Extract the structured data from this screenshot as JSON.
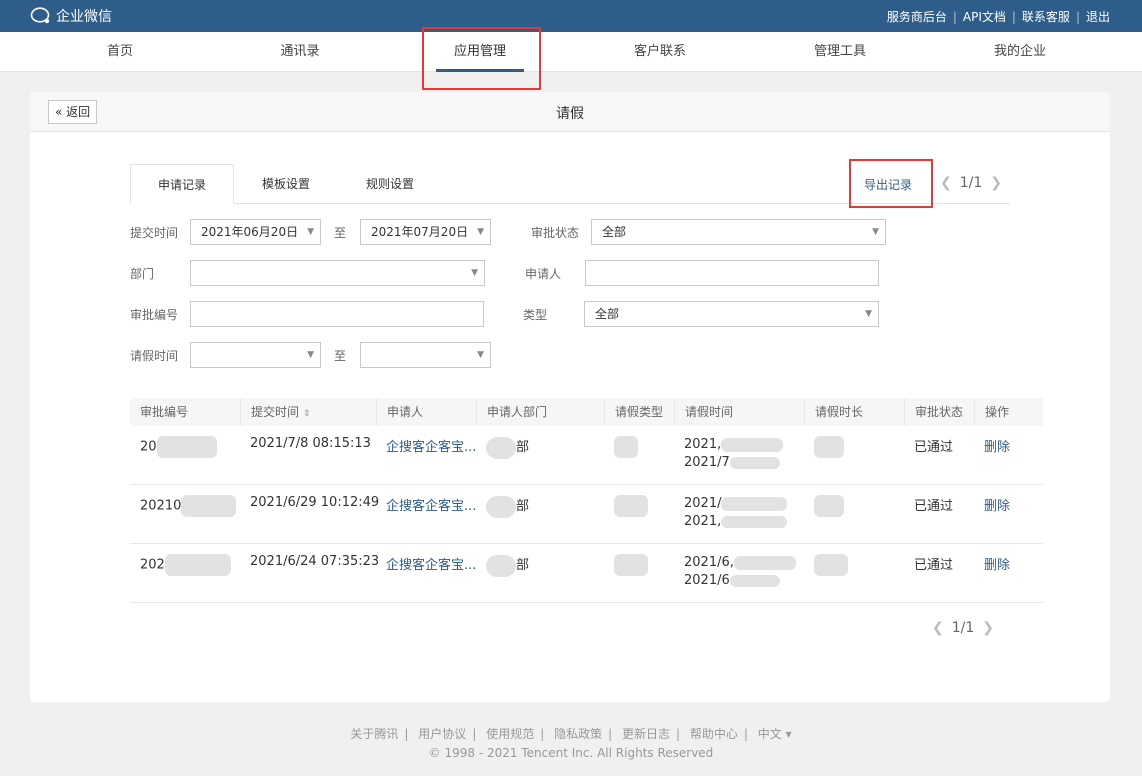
{
  "topbar": {
    "app_name": "企业微信",
    "links": [
      "服务商后台",
      "API文档",
      "联系客服",
      "退出"
    ]
  },
  "nav": {
    "items": [
      "首页",
      "通讯录",
      "应用管理",
      "客户联系",
      "管理工具",
      "我的企业"
    ],
    "active": "应用管理"
  },
  "page": {
    "back_label": "返回",
    "title": "请假"
  },
  "tabs": [
    "申请记录",
    "模板设置",
    "规则设置"
  ],
  "toolbar": {
    "export_label": "导出记录",
    "page_indicator": "1/1"
  },
  "filters": {
    "submit_time_label": "提交时间",
    "submit_start": "2021年06月20日",
    "to_label": "至",
    "submit_end": "2021年07月20日",
    "status_label": "审批状态",
    "status_value": "全部",
    "dept_label": "部门",
    "applicant_label": "申请人",
    "approval_no_label": "审批编号",
    "type_label": "类型",
    "type_value": "全部",
    "leave_time_label": "请假时间"
  },
  "table": {
    "headers": [
      "审批编号",
      "提交时间",
      "申请人",
      "申请人部门",
      "请假类型",
      "请假时间",
      "请假时长",
      "审批状态",
      "操作"
    ],
    "rows": [
      {
        "no": "20",
        "submitted": "2021/7/8 08:15:13",
        "applicant": "企搜客企客宝...",
        "dept": "部",
        "time1": "2021,",
        "time2": "2021/7",
        "status": "已通过",
        "action": "删除"
      },
      {
        "no": "20210",
        "submitted": "2021/6/29 10:12:49",
        "applicant": "企搜客企客宝...",
        "dept": "部",
        "time1": "2021/",
        "time2": "2021,",
        "status": "已通过",
        "action": "删除"
      },
      {
        "no": "202",
        "submitted": "2021/6/24 07:35:23",
        "applicant": "企搜客企客宝...",
        "dept": "部",
        "time1": "2021/6,",
        "time2": "2021/6",
        "status": "已通过",
        "action": "删除"
      }
    ]
  },
  "pager": {
    "label": "1/1"
  },
  "footer": {
    "links": [
      "关于腾讯",
      "用户协议",
      "使用规范",
      "隐私政策",
      "更新日志",
      "帮助中心",
      "中文 ▾"
    ],
    "copyright": "© 1998 - 2021 Tencent Inc. All Rights Reserved"
  },
  "colors": {
    "brand": "#2f5d89",
    "highlight": "#e53935"
  }
}
